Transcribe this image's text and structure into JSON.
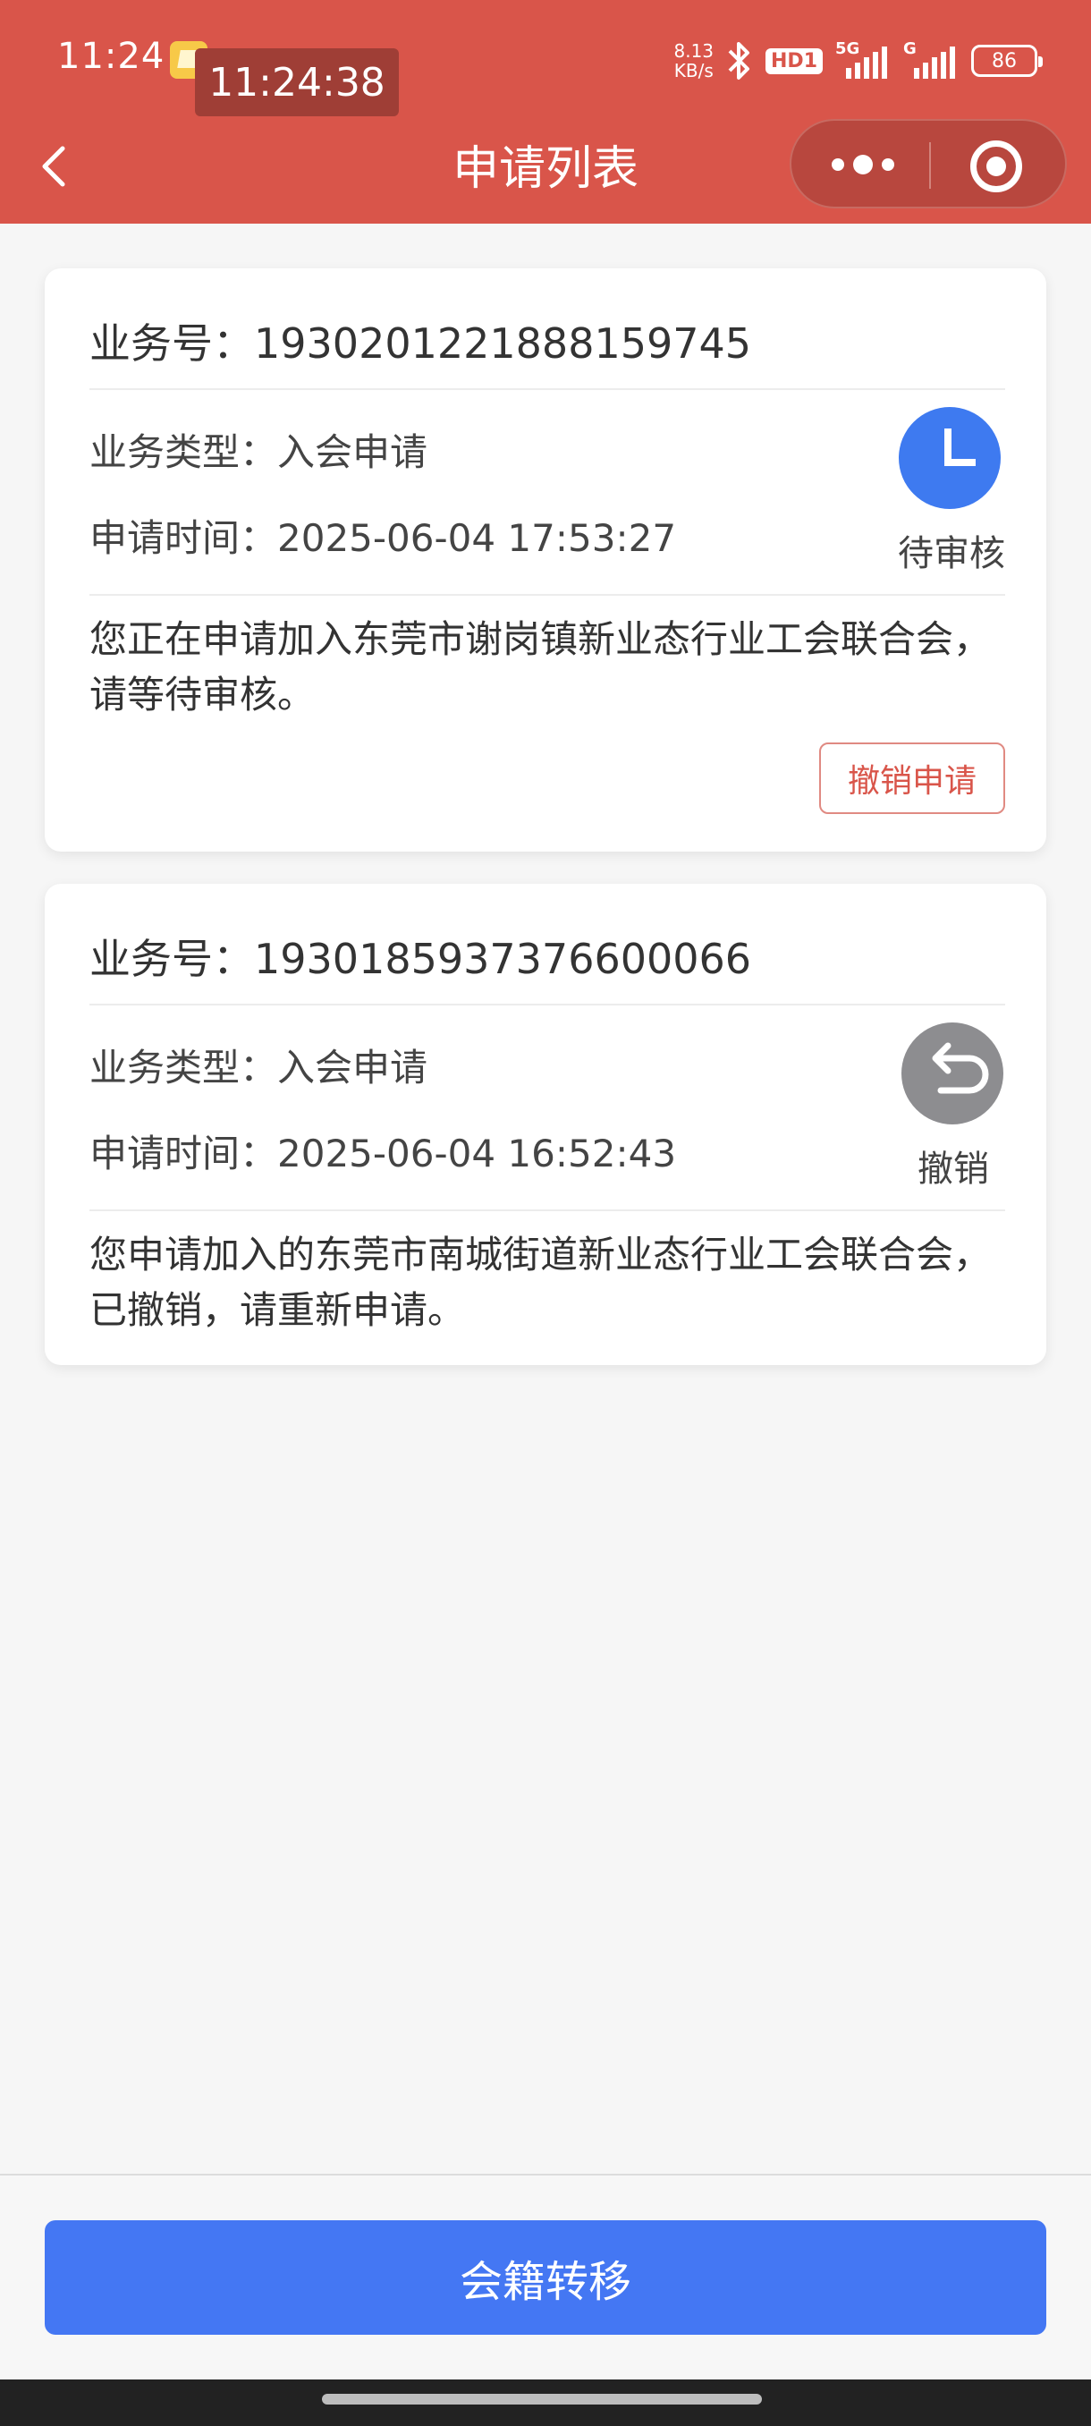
{
  "status_bar": {
    "time": "11:24",
    "overlay_clock": "11:24:38",
    "net_speed_value": "8.13",
    "net_speed_unit": "KB/s",
    "hd_label": "HD1",
    "signal_label_1": "5G",
    "signal_label_2": "G",
    "battery": "86"
  },
  "header": {
    "title": "申请列表",
    "back_icon": "chevron-left-icon",
    "more_icon": "more-dots-icon",
    "close_icon": "target-circle-icon"
  },
  "applications": [
    {
      "business_no": "业务号：1930201221888159745",
      "type": "业务类型：入会申请",
      "time": "申请时间：2025-06-04 17:53:27",
      "status": "待审核",
      "status_icon": "clock-icon",
      "status_color": "#3e7af0",
      "message": "您正在申请加入东莞市谢岗镇新业态行业工会联合会，请等待审核。",
      "action": "撤销申请"
    },
    {
      "business_no": "业务号：1930185937376600066",
      "type": "业务类型：入会申请",
      "time": "申请时间：2025-06-04 16:52:43",
      "status": "撤销",
      "status_icon": "undo-arrow-icon",
      "status_color": "#8d8d90",
      "message": "您申请加入的东莞市南城街道新业态行业工会联合会，已撤销，请重新申请。"
    }
  ],
  "footer": {
    "button_label": "会籍转移",
    "button_color": "#4477f3"
  },
  "colors": {
    "header_bg": "#d9554a",
    "page_bg": "#f6f6f6"
  }
}
